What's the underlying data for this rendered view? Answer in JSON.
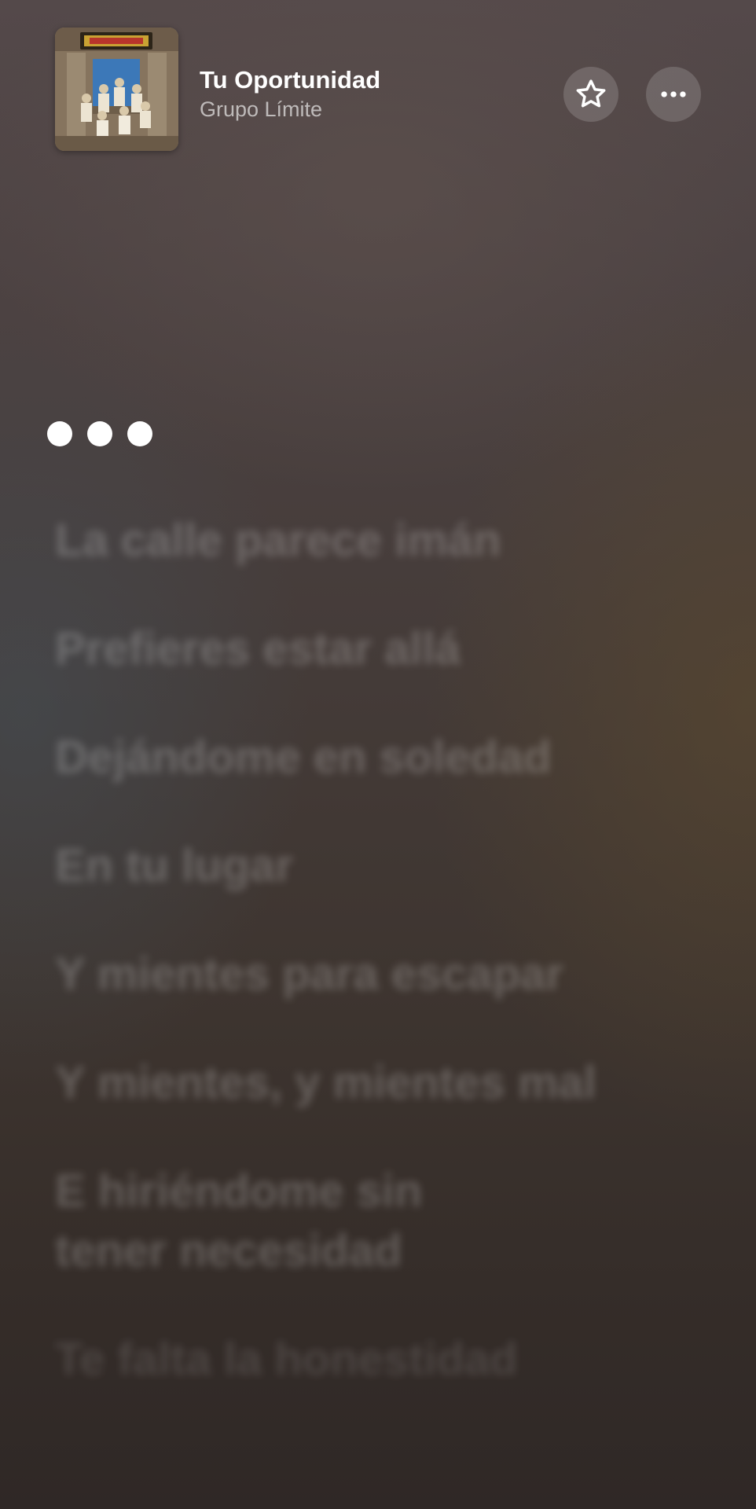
{
  "now_playing": {
    "title": "Tu Oportunidad",
    "artist": "Grupo Límite",
    "artwork_icon": "album-artwork"
  },
  "actions": {
    "favorite_icon": "star-icon",
    "more_icon": "ellipsis-icon"
  },
  "lyrics": {
    "lines": [
      "La calle parece imán",
      "Prefieres estar allá",
      "Dejándome en soledad",
      "En tu lugar",
      "Y mientes para escapar",
      "Y mientes, y mientes mal",
      "E hiriéndome sin",
      "tener necesidad",
      "Te falta la honestidad"
    ]
  },
  "colors": {
    "text_primary": "#ffffff",
    "text_secondary": "#b8b2ae",
    "button_bg": "rgba(255,255,255,0.16)"
  }
}
